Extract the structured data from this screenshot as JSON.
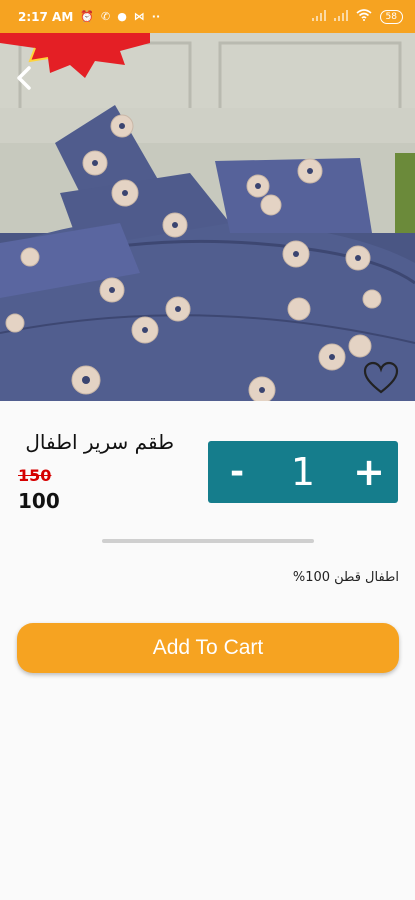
{
  "status_bar": {
    "time": "2:17 AM",
    "battery": "58"
  },
  "product": {
    "title": "طقم سرير اطفال",
    "old_price": "150",
    "price": "100",
    "quantity": "1",
    "description": "اطفال قطن 100%"
  },
  "stepper": {
    "minus_label": "-",
    "plus_label": "+"
  },
  "actions": {
    "add_to_cart_label": "Add To Cart"
  },
  "colors": {
    "accent": "#f6a321",
    "stepper": "#157d8c",
    "old_price": "#d50000"
  },
  "icons": {
    "back": "back-chevron-icon",
    "wishlist": "heart-outline-icon"
  }
}
